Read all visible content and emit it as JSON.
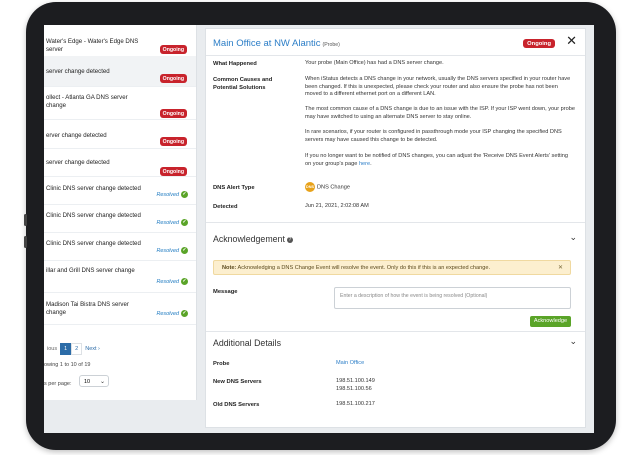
{
  "list": {
    "items": [
      {
        "title": "Water's Edge - Water's Edge DNS server",
        "status": "Ongoing"
      },
      {
        "title": "server change detected",
        "status": "Ongoing"
      },
      {
        "title": "ollect - Atlanta GA DNS server change",
        "status": "Ongoing"
      },
      {
        "title": "erver change detected",
        "status": "Ongoing"
      },
      {
        "title": "server change detected",
        "status": "Ongoing"
      },
      {
        "title": "Clinic DNS server change detected",
        "status": "Resolved"
      },
      {
        "title": "Clinic DNS server change detected",
        "status": "Resolved"
      },
      {
        "title": "Clinic DNS server change detected",
        "status": "Resolved"
      },
      {
        "title": "illar and Grill DNS server change",
        "status": "Resolved"
      },
      {
        "title": "Madison Tai Bistra DNS server change",
        "status": "Resolved"
      }
    ],
    "pager": {
      "prev": "ious",
      "page1": "1",
      "page2": "2",
      "next": "Next ›"
    },
    "showing": "owing 1 to 10 of 19",
    "per_page_label": "s per page:",
    "per_page_value": "10"
  },
  "detail": {
    "title": "Main Office at NW Alantic",
    "title_suffix": "(Probe)",
    "status": "Ongoing",
    "close": "✕",
    "what_happened_label": "What Happened",
    "what_happened": "Your probe (Main Office) has had a DNS server change.",
    "causes_label": "Common Causes and Potential Solutions",
    "causes_p1": "When iStatus detects a DNS change in your network, usually the DNS servers specified in your router have been changed. If this is unexpected, please check your router and also ensure the probe has not been moved to a different ethernet port on a different LAN.",
    "causes_p2": "The most common cause of a DNS change is due to an issue with the ISP. If your ISP went down, your probe may have switched to using an alternate DNS server to stay online.",
    "causes_p3": "In rare scenarios, if your router is configured in passthrough mode your ISP changing the specified DNS servers may have caused this change to be detected.",
    "causes_p4_pre": "If you no longer want to be notified of DNS changes, you can adjust the 'Receive DNS Event Alerts' setting on your group's page ",
    "causes_p4_link": "here",
    "causes_p4_post": ".",
    "alert_type_label": "DNS Alert Type",
    "alert_icon_text": "DNS",
    "alert_type": "DNS Change",
    "detected_label": "Detected",
    "detected": "Jun 21, 2021, 2:02:08 AM",
    "ack_title": "Acknowledgement",
    "note_bold": "Note:",
    "note_text": " Acknowledging a DNS Change Event will resolve the event. Only do this if this is an expected change.",
    "note_close": "✕",
    "message_label": "Message",
    "message_placeholder": "Enter a description of how the event is being resolved (Optional)",
    "ack_button": "Acknowledge",
    "additional_title": "Additional Details",
    "probe_label": "Probe",
    "probe_value": "Main Office",
    "new_dns_label": "New DNS Servers",
    "new_dns_1": "198.51.100.149",
    "new_dns_2": "198.51.100.56",
    "old_dns_label": "Old DNS Servers",
    "old_dns_1": "198.51.100.217"
  },
  "colors": {
    "accent": "#2c7ec7",
    "ongoing": "#c8232c",
    "resolved": "#5aa428",
    "note_bg": "#fcefcf"
  }
}
